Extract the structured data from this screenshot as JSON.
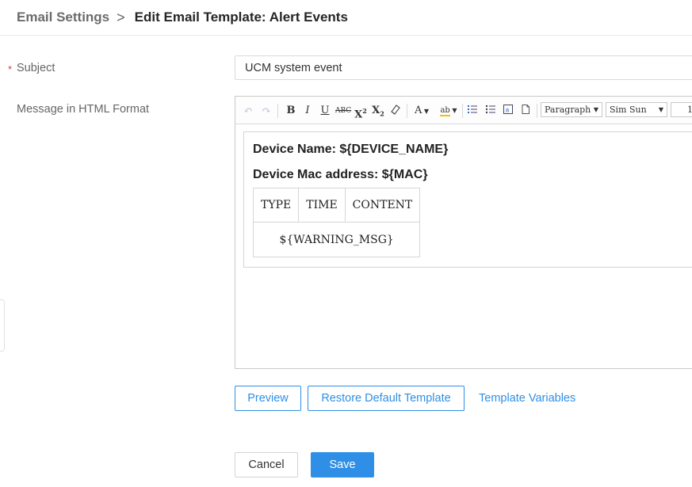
{
  "breadcrumb": {
    "parent": "Email Settings",
    "separator": ">",
    "current": "Edit Email Template: Alert Events"
  },
  "form": {
    "subject_required_mark": "*",
    "subject_label": "Subject",
    "subject_value": "UCM system event",
    "message_label": "Message in HTML Format"
  },
  "editor": {
    "toolbar": {
      "undo_icon": "undo-icon",
      "redo_icon": "redo-icon",
      "bold": "B",
      "italic": "I",
      "underline": "U",
      "strikethrough": "ABC",
      "superscript": "X",
      "superscript_mark": "2",
      "subscript": "X",
      "subscript_mark": "2",
      "font_color": "A",
      "highlight": "ab",
      "format_select": "Paragraph",
      "font_select": "Sim Sun",
      "size_select": "1"
    },
    "content": {
      "line1": "Device Name: ${DEVICE_NAME}",
      "line2": "Device Mac address: ${MAC}",
      "table_headers": [
        "TYPE",
        "TIME",
        "CONTENT"
      ],
      "table_cell": "${WARNING_MSG}"
    }
  },
  "actions": {
    "preview": "Preview",
    "restore": "Restore Default Template",
    "variables": "Template Variables",
    "cancel": "Cancel",
    "save": "Save"
  },
  "colors": {
    "accent": "#2f8fe6",
    "required": "#e0393e"
  }
}
